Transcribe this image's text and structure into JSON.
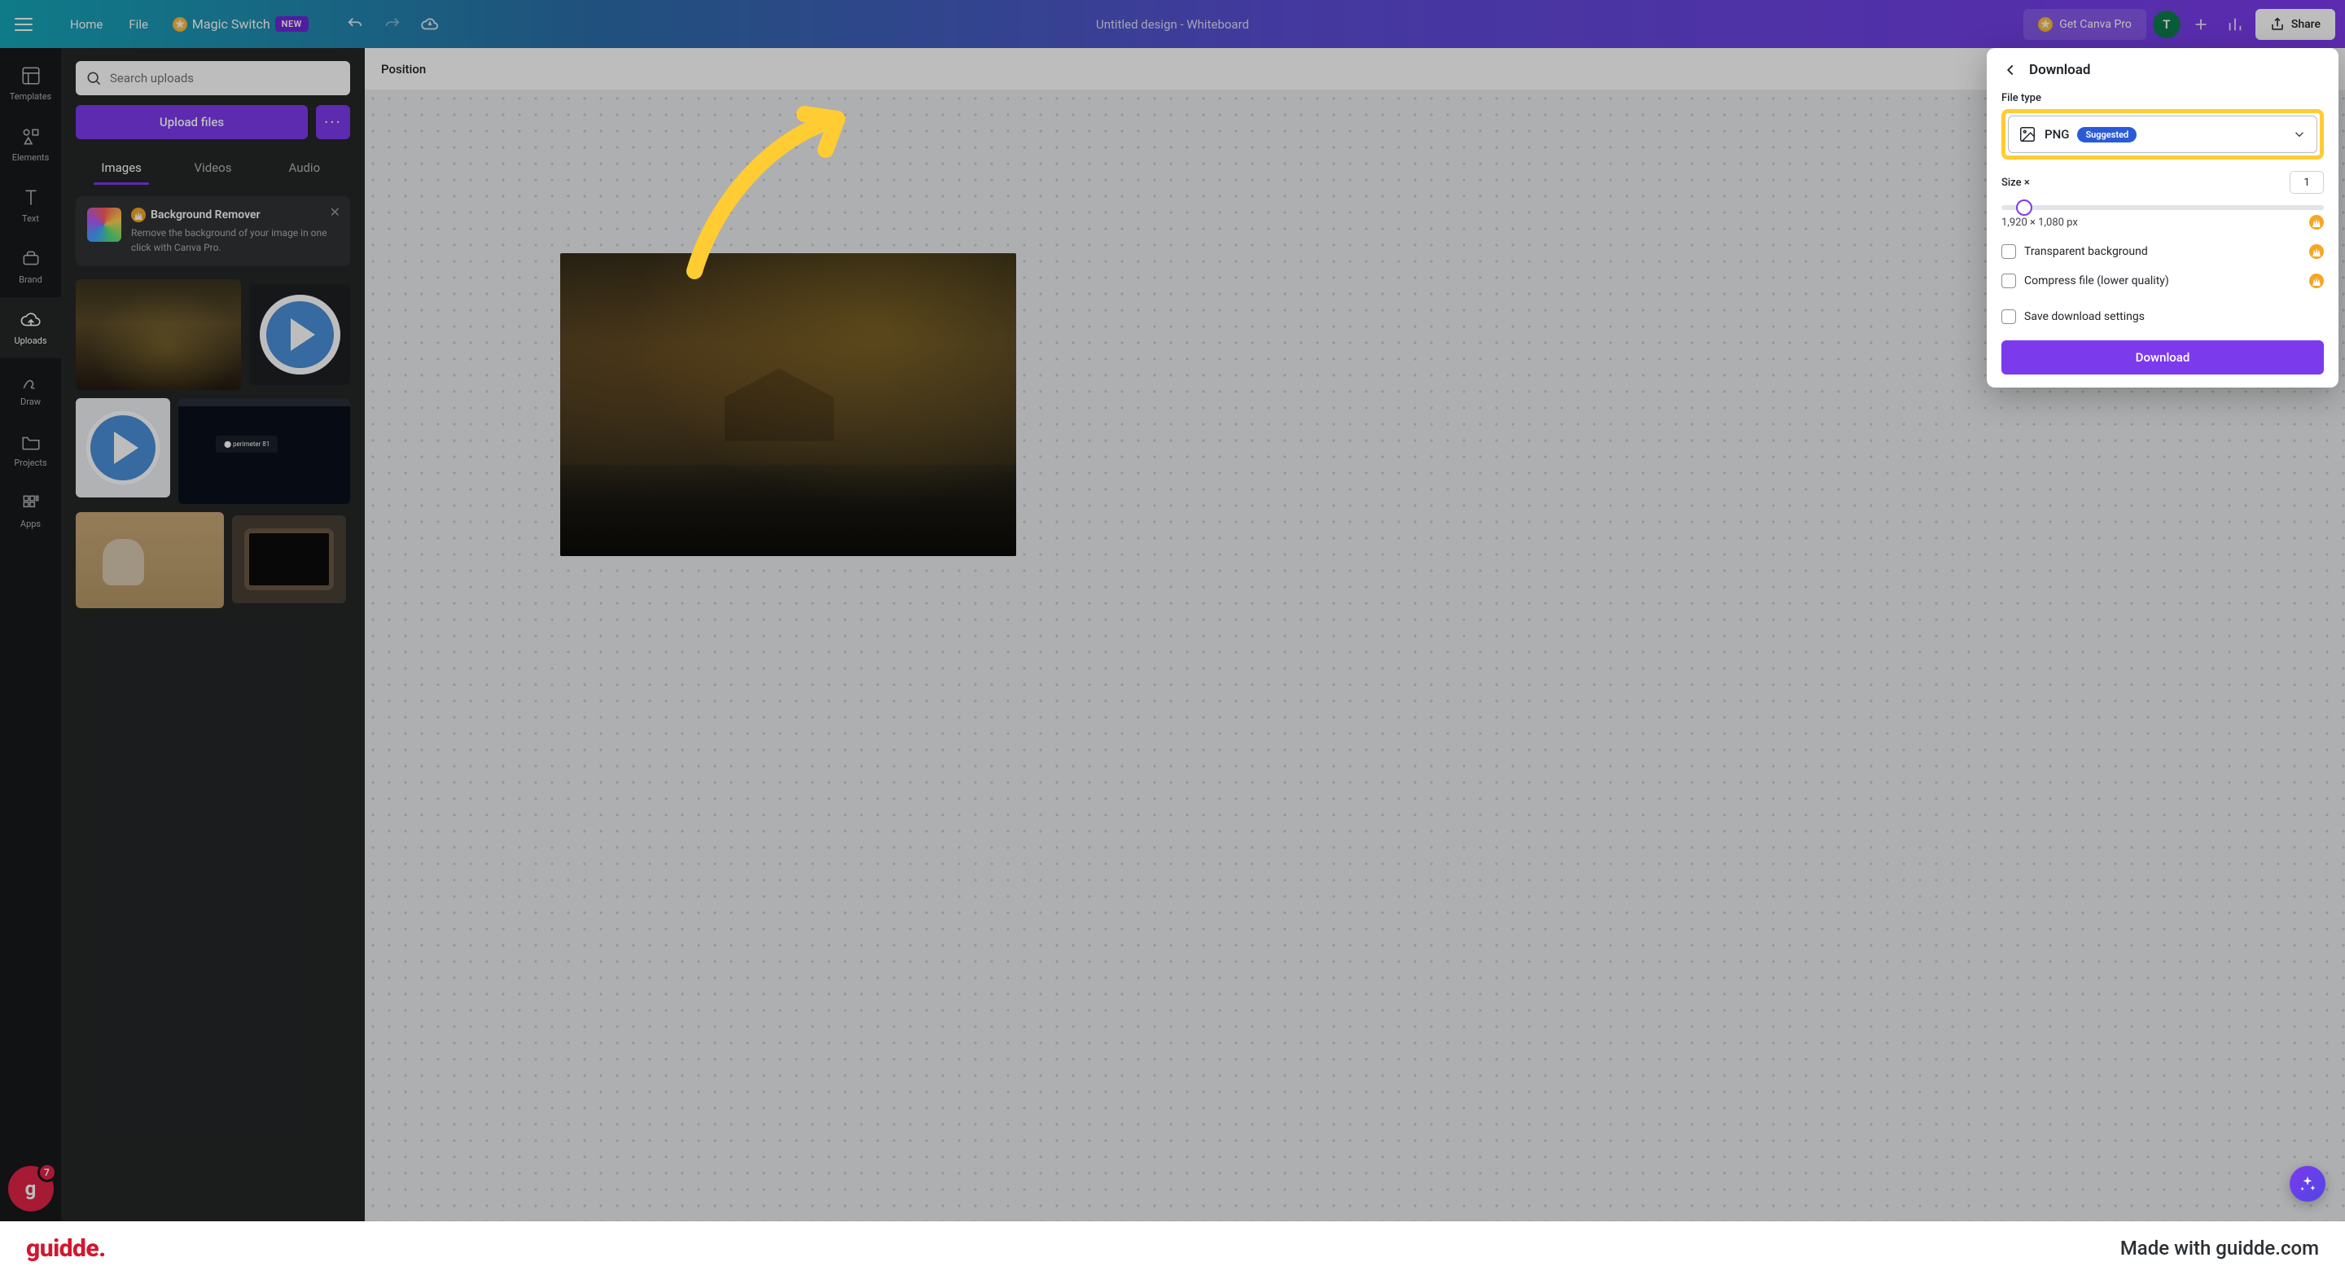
{
  "topbar": {
    "home": "Home",
    "file": "File",
    "magic": "Magic Switch",
    "new": "NEW",
    "title": "Untitled design - Whiteboard",
    "getPro": "Get Canva Pro",
    "avatar": "T",
    "share": "Share"
  },
  "rail": {
    "templates": "Templates",
    "elements": "Elements",
    "text": "Text",
    "brand": "Brand",
    "uploads": "Uploads",
    "draw": "Draw",
    "projects": "Projects",
    "apps": "Apps",
    "badge": "7"
  },
  "panel": {
    "searchPlaceholder": "Search uploads",
    "upload": "Upload files",
    "tabs": {
      "images": "Images",
      "videos": "Videos",
      "audio": "Audio"
    },
    "bgRemove": {
      "title": "Background Remover",
      "desc": "Remove the background of your image in one click with Canva Pro."
    }
  },
  "toolbar": {
    "position": "Position"
  },
  "download": {
    "title": "Download",
    "fileTypeLabel": "File type",
    "fileType": "PNG",
    "suggested": "Suggested",
    "sizeLabel": "Size ×",
    "sizeVal": "1",
    "dims": "1,920 × 1,080 px",
    "transparent": "Transparent background",
    "compress": "Compress file (lower quality)",
    "save": "Save download settings",
    "button": "Download"
  },
  "footer": {
    "logo": "guidde",
    "made": "Made with guidde.com"
  }
}
